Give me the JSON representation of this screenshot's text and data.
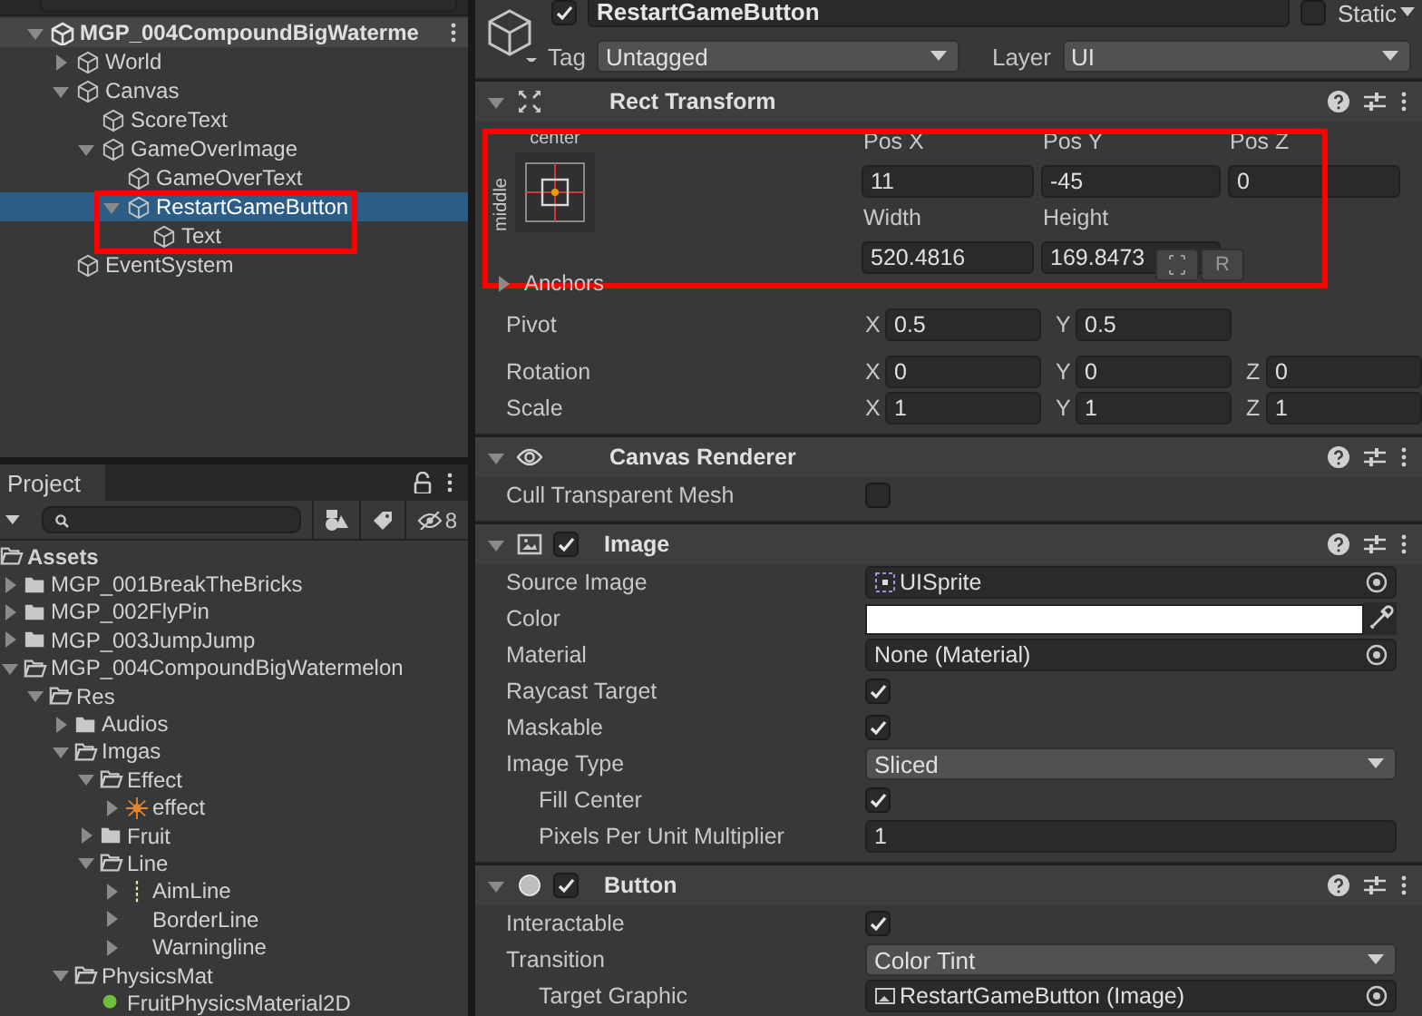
{
  "hierarchy": {
    "scene": {
      "label": "MGP_004CompoundBigWaterme",
      "expanded": true
    },
    "items": [
      {
        "label": "World",
        "expanded": false,
        "selected": false
      },
      {
        "label": "Canvas",
        "expanded": true,
        "selected": false,
        "children": [
          {
            "label": "ScoreText",
            "selected": false
          },
          {
            "label": "GameOverImage",
            "expanded": true,
            "selected": false,
            "children": [
              {
                "label": "GameOverText",
                "selected": false
              },
              {
                "label": "RestartGameButton",
                "expanded": true,
                "selected": true,
                "highlighted": true,
                "children": [
                  {
                    "label": "Text",
                    "selected": false
                  }
                ]
              }
            ]
          }
        ]
      },
      {
        "label": "EventSystem",
        "selected": false
      }
    ]
  },
  "project": {
    "tab": "Project",
    "hidden_count": "8",
    "items": [
      {
        "label": "Assets",
        "kind": "folder",
        "children": [
          {
            "label": "MGP_001BreakTheBricks",
            "kind": "folder",
            "expanded": false
          },
          {
            "label": "MGP_002FlyPin",
            "kind": "folder",
            "expanded": false
          },
          {
            "label": "MGP_003JumpJump",
            "kind": "folder",
            "expanded": false
          },
          {
            "label": "MGP_004CompoundBigWatermelon",
            "kind": "folder",
            "expanded": true,
            "children": [
              {
                "label": "Res",
                "kind": "folder",
                "expanded": true,
                "children": [
                  {
                    "label": "Audios",
                    "kind": "folder",
                    "expanded": false
                  },
                  {
                    "label": "Imgas",
                    "kind": "folder",
                    "expanded": true,
                    "children": [
                      {
                        "label": "Effect",
                        "kind": "folder",
                        "expanded": true,
                        "children": [
                          {
                            "label": "effect",
                            "kind": "sprite",
                            "expanded": false
                          }
                        ]
                      },
                      {
                        "label": "Fruit",
                        "kind": "folder",
                        "expanded": false
                      },
                      {
                        "label": "Line",
                        "kind": "folder",
                        "expanded": true,
                        "children": [
                          {
                            "label": "AimLine",
                            "kind": "line",
                            "expanded": false
                          },
                          {
                            "label": "BorderLine",
                            "expanded": false
                          },
                          {
                            "label": "Warningline",
                            "expanded": false
                          }
                        ]
                      }
                    ]
                  },
                  {
                    "label": "PhysicsMat",
                    "kind": "folder",
                    "expanded": true,
                    "children": [
                      {
                        "label": "FruitPhysicsMaterial2D",
                        "kind": "material"
                      }
                    ]
                  }
                ]
              }
            ]
          }
        ]
      }
    ]
  },
  "inspector": {
    "object": {
      "active": true,
      "name": "RestartGameButton",
      "static": false,
      "static_label": "Static",
      "tag_label": "Tag",
      "tag": "Untagged",
      "layer_label": "Layer",
      "layer": "UI"
    },
    "components": [
      {
        "kind": "rect_transform",
        "title": "Rect Transform",
        "expanded": true,
        "anchor_x": "center",
        "anchor_y": "middle",
        "highlighted": true,
        "fields": [
          {
            "label": "Pos X",
            "value": "11"
          },
          {
            "label": "Pos Y",
            "value": "-45"
          },
          {
            "label": "Pos Z",
            "value": "0"
          },
          {
            "label": "Width",
            "value": "520.4816"
          },
          {
            "label": "Height",
            "value": "169.8473"
          }
        ],
        "raw_button": "R",
        "anchors": {
          "label": "Anchors",
          "expanded": false
        },
        "vectors": [
          {
            "label": "Pivot",
            "axes": [
              {
                "axis": "X",
                "value": "0.5"
              },
              {
                "axis": "Y",
                "value": "0.5"
              }
            ]
          },
          {
            "label": "Rotation",
            "axes": [
              {
                "axis": "X",
                "value": "0"
              },
              {
                "axis": "Y",
                "value": "0"
              },
              {
                "axis": "Z",
                "value": "0"
              }
            ]
          },
          {
            "label": "Scale",
            "axes": [
              {
                "axis": "X",
                "value": "1"
              },
              {
                "axis": "Y",
                "value": "1"
              },
              {
                "axis": "Z",
                "value": "1"
              }
            ]
          }
        ]
      },
      {
        "kind": "canvas_renderer",
        "title": "Canvas Renderer",
        "expanded": true,
        "properties": [
          {
            "kind": "checkbox",
            "label": "Cull Transparent Mesh",
            "checked": false
          }
        ]
      },
      {
        "kind": "image",
        "title": "Image",
        "expanded": true,
        "enabled": true,
        "properties": [
          {
            "kind": "sprite_object",
            "label": "Source Image",
            "value": "UISprite"
          },
          {
            "kind": "color",
            "label": "Color",
            "color": "#ffffff"
          },
          {
            "kind": "object",
            "label": "Material",
            "value": "None (Material)"
          },
          {
            "kind": "checkbox",
            "label": "Raycast Target",
            "checked": true
          },
          {
            "kind": "checkbox",
            "label": "Maskable",
            "checked": true
          },
          {
            "kind": "dropdown",
            "label": "Image Type",
            "value": "Sliced"
          },
          {
            "kind": "checkbox",
            "label": "Fill Center",
            "checked": true,
            "indented": true
          },
          {
            "kind": "text",
            "label": "Pixels Per Unit Multiplier",
            "value": "1",
            "indented": true
          }
        ]
      },
      {
        "kind": "button",
        "title": "Button",
        "expanded": true,
        "enabled": true,
        "properties": [
          {
            "kind": "checkbox",
            "label": "Interactable",
            "checked": true
          },
          {
            "kind": "dropdown",
            "label": "Transition",
            "value": "Color Tint"
          },
          {
            "kind": "image_object",
            "label": "Target Graphic",
            "value": "RestartGameButton (Image)",
            "indented": true
          }
        ]
      }
    ]
  }
}
